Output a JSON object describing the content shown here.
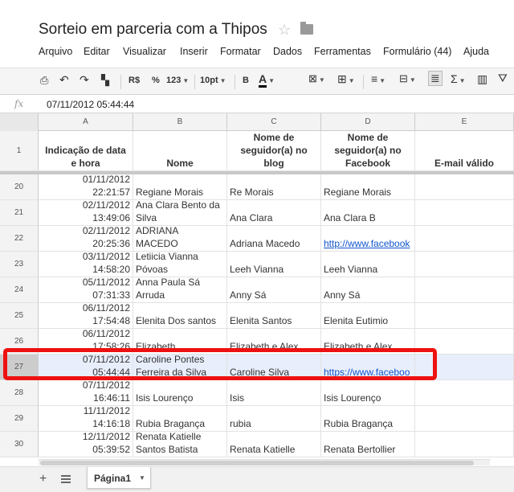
{
  "document": {
    "title": "Sorteio em parceria com a Thipos",
    "star_icon": "star-icon",
    "folder_icon": "folder-icon"
  },
  "menu": [
    "Arquivo",
    "Editar",
    "Visualizar",
    "Inserir",
    "Formatar",
    "Dados",
    "Ferramentas",
    "Formulário (44)",
    "Ajuda"
  ],
  "toolbar": {
    "currency": "R$",
    "percent": "%",
    "number_format": "123",
    "font_size": "10pt",
    "bold": "B",
    "text_color": "A",
    "sum": "Σ"
  },
  "formula_bar": {
    "fx_label": "fx",
    "value": "07/11/2012 05:44:44"
  },
  "columns": [
    "A",
    "B",
    "C",
    "D",
    "E"
  ],
  "header": {
    "row_number": "1",
    "cells": [
      [
        "Indicação de data",
        "e hora"
      ],
      [
        "Nome"
      ],
      [
        "Nome de",
        "seguidor(a) no",
        "blog"
      ],
      [
        "Nome de",
        "seguidor(a) no",
        "Facebook"
      ],
      [
        "E-mail válido"
      ]
    ]
  },
  "rows": [
    {
      "n": "20",
      "date": "01/11/2012",
      "time": "22:21:57",
      "name": [
        "Regiane Morais"
      ],
      "blog": "Re Morais",
      "facebook": "Regiane Morais",
      "fb_link": false
    },
    {
      "n": "21",
      "date": "02/11/2012",
      "time": "13:49:06",
      "name": [
        "Ana Clara Bento da",
        "Silva"
      ],
      "blog": "Ana Clara",
      "facebook": "Ana Clara B",
      "fb_link": false
    },
    {
      "n": "22",
      "date": "02/11/2012",
      "time": "20:25:36",
      "name": [
        "ADRIANA",
        "MACEDO"
      ],
      "blog": "Adriana Macedo",
      "facebook": "http://www.facebook",
      "fb_link": true
    },
    {
      "n": "23",
      "date": "03/11/2012",
      "time": "14:58:20",
      "name": [
        "Letiicia Vianna",
        "Póvoas"
      ],
      "blog": "Leeh Vianna",
      "facebook": "Leeh Vianna",
      "fb_link": false
    },
    {
      "n": "24",
      "date": "05/11/2012",
      "time": "07:31:33",
      "name": [
        "Anna Paula Sá",
        "Arruda"
      ],
      "blog": "Anny Sá",
      "facebook": "Anny Sá",
      "fb_link": false
    },
    {
      "n": "25",
      "date": "06/11/2012",
      "time": "17:54:48",
      "name": [
        "Elenita Dos santos"
      ],
      "blog": "Elenita Santos",
      "facebook": "Elenita Eutimio",
      "fb_link": false
    },
    {
      "n": "26",
      "date": "06/11/2012",
      "time": "17:58:26",
      "name": [
        "Elizabeth"
      ],
      "blog": "Elizabeth e Alex",
      "facebook": "Elizabeth e Alex",
      "fb_link": false
    },
    {
      "n": "27",
      "date": "07/11/2012",
      "time": "05:44:44",
      "name": [
        "Caroline Pontes",
        "Ferreira da Silva"
      ],
      "blog": "Caroline Silva",
      "facebook": "https://www.faceboo",
      "fb_link": true,
      "selected": true
    },
    {
      "n": "28",
      "date": "07/11/2012",
      "time": "16:46:11",
      "name": [
        "Isis Lourenço"
      ],
      "blog": "Isis",
      "facebook": "Isis Lourenço",
      "fb_link": false
    },
    {
      "n": "29",
      "date": "11/11/2012",
      "time": "14:16:18",
      "name": [
        "Rubia Bragança"
      ],
      "blog": "rubia",
      "facebook": "Rubia Bragança",
      "fb_link": false
    },
    {
      "n": "30",
      "date": "12/11/2012",
      "time": "05:39:52",
      "name": [
        "Renata Katielle",
        "Santos Batista"
      ],
      "blog": "Renata Katielle",
      "facebook": "Renata Bertollier",
      "fb_link": false
    }
  ],
  "sheet": {
    "add_label": "+",
    "tab_label": "Página1"
  },
  "colors": {
    "highlight": "#ee1111",
    "link": "#1155cc",
    "selected_row": "#e8eefb"
  }
}
